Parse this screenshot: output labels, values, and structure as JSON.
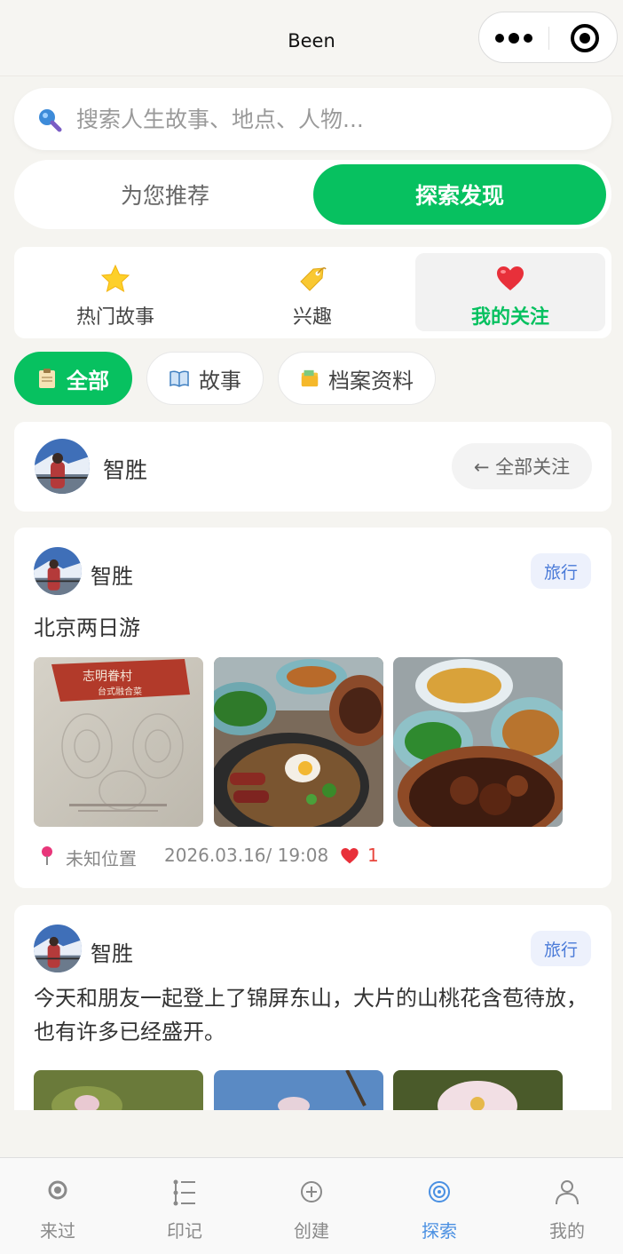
{
  "app": {
    "title": "Been"
  },
  "search": {
    "placeholder": "搜索人生故事、地点、人物..."
  },
  "segments": {
    "left": "为您推荐",
    "right": "探索发现"
  },
  "categories": [
    {
      "label": "热门故事",
      "icon": "star-icon"
    },
    {
      "label": "兴趣",
      "icon": "tag-icon"
    },
    {
      "label": "我的关注",
      "icon": "heart-icon"
    }
  ],
  "filters": [
    {
      "label": "全部",
      "icon": "clipboard-icon"
    },
    {
      "label": "故事",
      "icon": "book-icon"
    },
    {
      "label": "档案资料",
      "icon": "folder-icon"
    }
  ],
  "followed_user": {
    "name": "智胜",
    "back_button": "← 全部关注"
  },
  "posts": [
    {
      "author": "智胜",
      "tag": "旅行",
      "text": "北京两日游",
      "location": "未知位置",
      "time": "2026.03.16/ 19:08",
      "likes": "1"
    },
    {
      "author": "智胜",
      "tag": "旅行",
      "text": "今天和朋友一起登上了锦屏东山，大片的山桃花含苞待放，也有许多已经盛开。"
    }
  ],
  "photo_text": {
    "menu_title": "志明眷村",
    "menu_subtitle": "台式融合菜"
  },
  "tabbar": [
    {
      "label": "来过",
      "icon": "record-icon"
    },
    {
      "label": "印记",
      "icon": "timeline-icon"
    },
    {
      "label": "创建",
      "icon": "plus-circle-icon"
    },
    {
      "label": "探索",
      "icon": "explore-icon"
    },
    {
      "label": "我的",
      "icon": "user-icon"
    }
  ],
  "colors": {
    "accent": "#07c160",
    "tab_active": "#4a90e2",
    "tag_text": "#4a7ad8",
    "like": "#e8453c"
  }
}
